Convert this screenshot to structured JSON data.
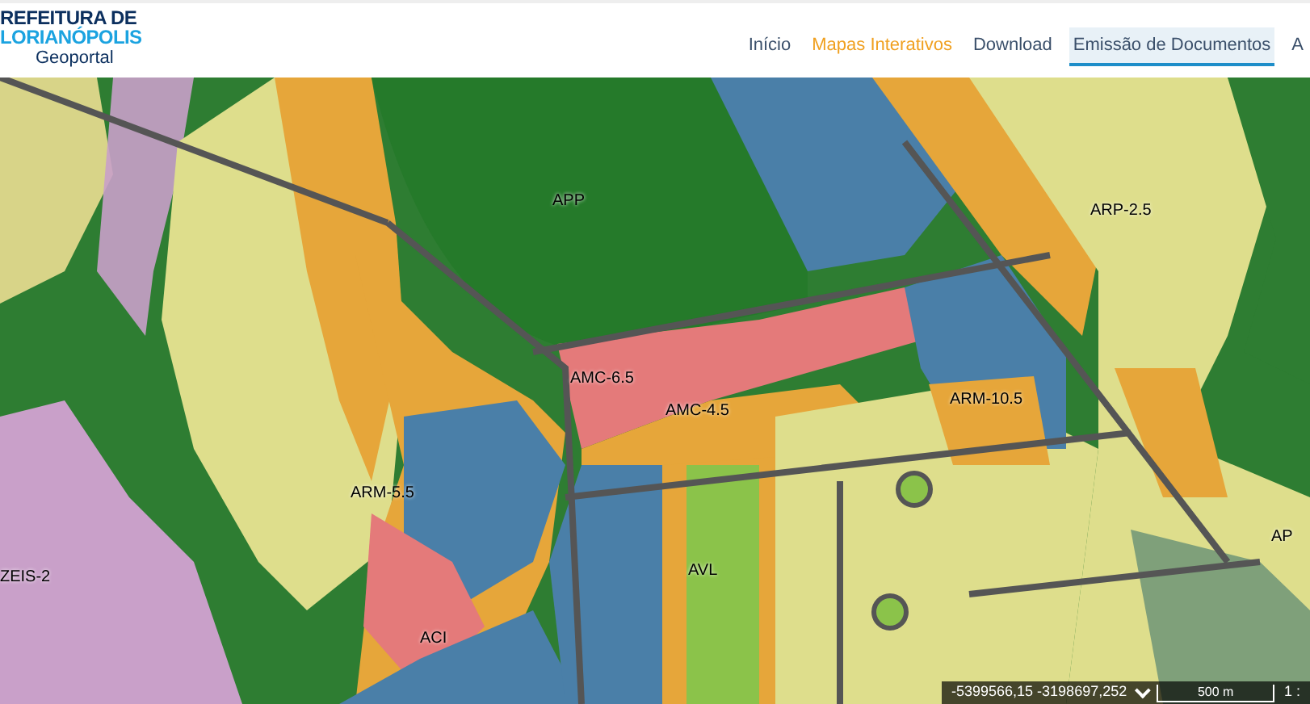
{
  "logo": {
    "line_1": "REFEITURA DE",
    "line_2": "LORIANÓPOLIS",
    "subtitle": "Geoportal"
  },
  "nav": [
    {
      "label": "Início",
      "selected": false,
      "focused": false
    },
    {
      "label": "Mapas Interativos",
      "selected": true,
      "focused": false
    },
    {
      "label": "Download",
      "selected": false,
      "focused": false
    },
    {
      "label": "Emissão de Documentos",
      "selected": false,
      "focused": true
    },
    {
      "label": "A",
      "selected": false,
      "focused": false
    }
  ],
  "map": {
    "zone_labels": [
      "APP",
      "ARP-2.5",
      "AMC-6.5",
      "AMC-4.5",
      "ARM-10.5",
      "ARM-5.5",
      "ZEIS-2",
      "AVL",
      "ACI",
      "AP"
    ],
    "coordinates": "-5399566,15 -3198697,252",
    "scale": "500 m",
    "ratio": "1 :"
  }
}
